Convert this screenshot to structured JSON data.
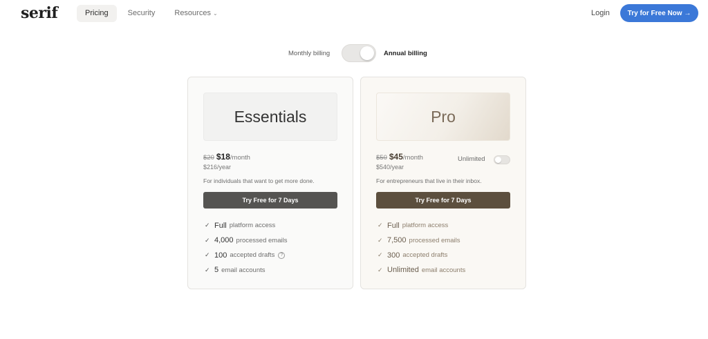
{
  "header": {
    "logo": "serif",
    "nav": [
      {
        "label": "Pricing",
        "active": true
      },
      {
        "label": "Security",
        "active": false
      },
      {
        "label": "Resources",
        "active": false
      }
    ],
    "login": "Login",
    "cta": "Try for Free Now →"
  },
  "billing": {
    "monthly_label": "Monthly billing",
    "annual_label": "Annual billing",
    "annual_selected": true
  },
  "plans": [
    {
      "name": "Essentials",
      "old_price": "$20",
      "price": "$18",
      "period": "/month",
      "yearly": "$216/year",
      "description": "For individuals that want to get more done.",
      "button": "Try Free for 7 Days",
      "features": [
        {
          "strong": "Full",
          "text": "platform access"
        },
        {
          "strong": "4,000",
          "text": "processed emails"
        },
        {
          "strong": "100",
          "text": "accepted drafts"
        },
        {
          "strong": "5",
          "text": "email accounts"
        }
      ]
    },
    {
      "name": "Pro",
      "old_price": "$50",
      "price": "$45",
      "period": "/month",
      "yearly": "$540/year",
      "description": "For entrepreneurs that live in their inbox.",
      "unlimited_label": "Unlimited",
      "unlimited_on": false,
      "button": "Try Free for 7 Days",
      "features": [
        {
          "strong": "Full",
          "text": "platform access"
        },
        {
          "strong": "7,500",
          "text": "processed emails"
        },
        {
          "strong": "300",
          "text": "accepted drafts"
        },
        {
          "strong": "Unlimited",
          "text": "email accounts"
        }
      ]
    }
  ],
  "icons": {
    "check": "check-icon",
    "help": "help-circle-icon",
    "chevron": "chevron-down-icon"
  },
  "colors": {
    "accent": "#3b78d8",
    "essentials_button": "#555452",
    "pro_button": "#5c4f3e"
  }
}
